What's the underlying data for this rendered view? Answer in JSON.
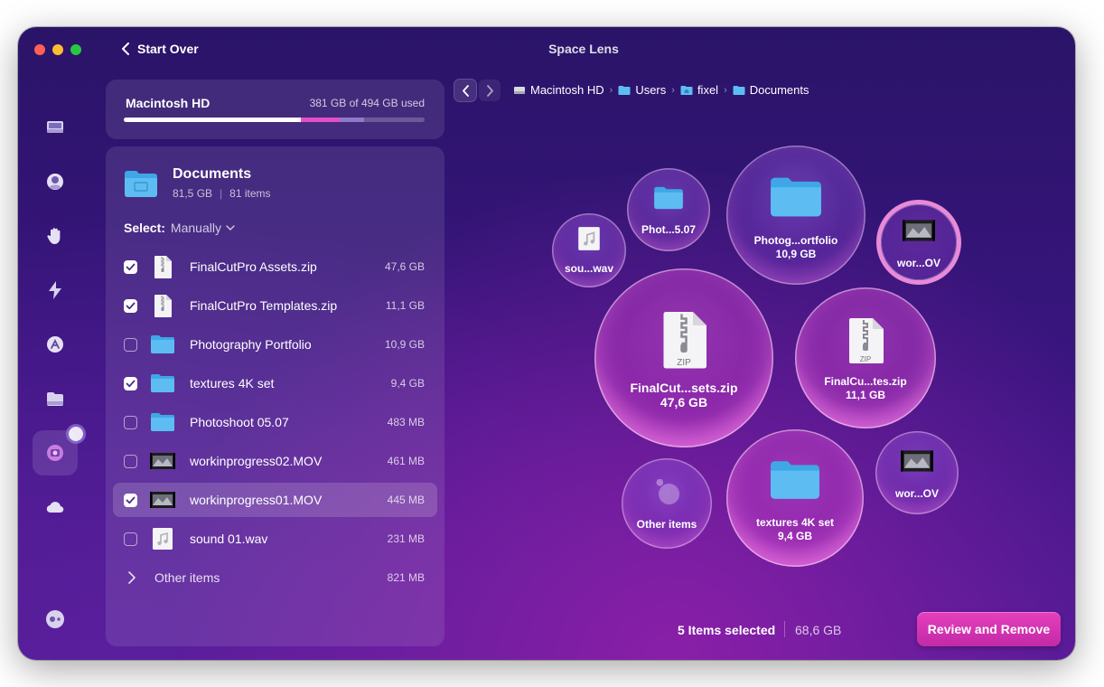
{
  "window": {
    "title": "Space Lens"
  },
  "toolbar": {
    "start_over_label": "Start Over"
  },
  "sidebar": {
    "items": [
      {
        "icon": "disk-icon"
      },
      {
        "icon": "privacy-icon"
      },
      {
        "icon": "hand-icon"
      },
      {
        "icon": "speed-icon"
      },
      {
        "icon": "applications-icon"
      },
      {
        "icon": "files-icon"
      },
      {
        "icon": "space-lens-icon",
        "active": true
      },
      {
        "icon": "cloud-icon"
      }
    ],
    "bottom_icon": "assistant-icon"
  },
  "disk": {
    "name": "Macintosh HD",
    "used_text": "381 GB of 494 GB used",
    "used_fraction": 0.59,
    "selected_fraction": 0.13,
    "other_fraction": 0.08,
    "colors": {
      "used": "#ffffff",
      "selected": "#e44fc6",
      "other": "#8e79c8"
    }
  },
  "folder": {
    "name": "Documents",
    "size": "81,5 GB",
    "items": "81 items"
  },
  "select": {
    "label": "Select:",
    "value": "Manually"
  },
  "files": [
    {
      "name": "FinalCutPro Assets.zip",
      "size": "47,6 GB",
      "checked": true,
      "type": "zip",
      "highlighted": false
    },
    {
      "name": "FinalCutPro Templates.zip",
      "size": "11,1 GB",
      "checked": true,
      "type": "zip",
      "highlighted": false
    },
    {
      "name": "Photography Portfolio",
      "size": "10,9 GB",
      "checked": false,
      "type": "folder",
      "highlighted": false
    },
    {
      "name": "textures 4K set",
      "size": "9,4 GB",
      "checked": true,
      "type": "folder",
      "highlighted": false
    },
    {
      "name": "Photoshoot 05.07",
      "size": "483 MB",
      "checked": false,
      "type": "folder",
      "highlighted": false
    },
    {
      "name": "workinprogress02.MOV",
      "size": "461 MB",
      "checked": false,
      "type": "video",
      "highlighted": false
    },
    {
      "name": "workinprogress01.MOV",
      "size": "445 MB",
      "checked": true,
      "type": "video",
      "highlighted": true
    },
    {
      "name": "sound 01.wav",
      "size": "231 MB",
      "checked": false,
      "type": "audio",
      "highlighted": false
    }
  ],
  "other_items": {
    "label": "Other items",
    "size": "821 MB"
  },
  "breadcrumb": [
    {
      "label": "Macintosh HD",
      "icon": "drive-icon"
    },
    {
      "label": "Users",
      "icon": "folder-icon"
    },
    {
      "label": "fixel",
      "icon": "home-folder-icon"
    },
    {
      "label": "Documents",
      "icon": "folder-icon"
    }
  ],
  "bubbles": [
    {
      "label": "sou...wav",
      "size": "",
      "type": "audio"
    },
    {
      "label": "Phot...5.07",
      "size": "",
      "type": "folder"
    },
    {
      "label": "Photog...ortfolio",
      "size": "10,9 GB",
      "type": "folder"
    },
    {
      "label": "wor...OV",
      "size": "",
      "type": "video"
    },
    {
      "label": "FinalCut...sets.zip",
      "size": "47,6 GB",
      "type": "zip"
    },
    {
      "label": "FinalCu...tes.zip",
      "size": "11,1 GB",
      "type": "zip"
    },
    {
      "label": "Other items",
      "size": "",
      "type": "other"
    },
    {
      "label": "textures 4K set",
      "size": "9,4 GB",
      "type": "folder"
    },
    {
      "label": "wor...OV",
      "size": "",
      "type": "video"
    }
  ],
  "zip_badge": "ZIP",
  "footer": {
    "selected_count": "5 Items selected",
    "selected_size": "68,6 GB",
    "review_label": "Review and Remove"
  }
}
